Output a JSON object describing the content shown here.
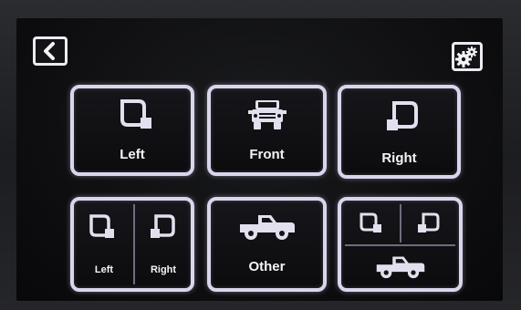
{
  "header": {
    "back_icon": "chevron-left-icon",
    "settings_icon": "gears-icon"
  },
  "views": {
    "left": {
      "label": "Left",
      "icon": "left-mirror-icon"
    },
    "front": {
      "label": "Front",
      "icon": "truck-front-icon"
    },
    "right": {
      "label": "Right",
      "icon": "right-mirror-icon"
    },
    "left_right": {
      "left_label": "Left",
      "right_label": "Right"
    },
    "other": {
      "label": "Other",
      "icon": "pickup-truck-icon"
    },
    "all": {
      "icon": "mirrors-and-truck-icon"
    }
  },
  "colors": {
    "button_border": "#d9d6ec",
    "icon_fill": "#e2e0ee",
    "label_text": "#f4f4f8"
  }
}
